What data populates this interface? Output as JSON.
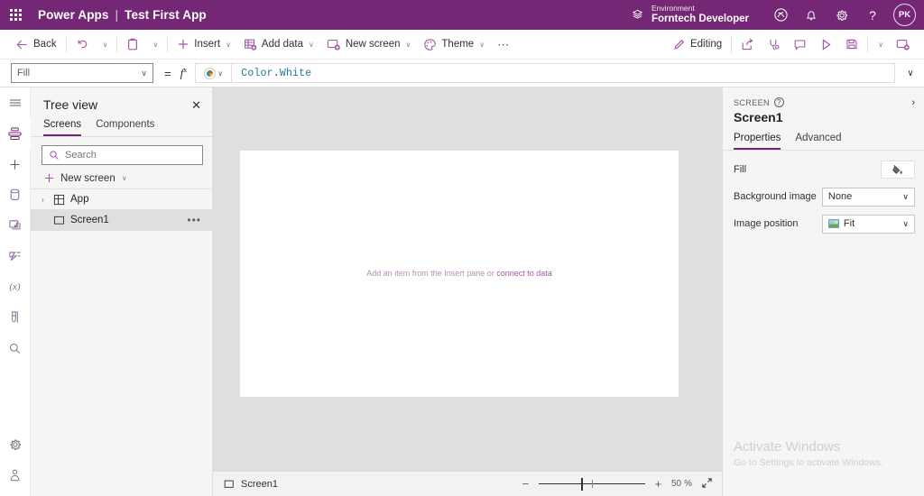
{
  "titlebar": {
    "waffle_label": "app-launcher",
    "product": "Power Apps",
    "separator": "|",
    "app_name": "Test First App",
    "environment_label": "Environment",
    "environment_name": "Forntech Developer",
    "icons": [
      "environment-icon",
      "copilot-icon",
      "notifications-icon",
      "settings-icon",
      "help-icon"
    ],
    "avatar_initials": "PK"
  },
  "commandbar": {
    "back": "Back",
    "undo": "undo-icon",
    "undo_chevron": "∨",
    "paste": "paste-icon",
    "paste_chevron": "∨",
    "insert": "Insert",
    "add_data": "Add data",
    "new_screen": "New screen",
    "theme": "Theme",
    "overflow": "⋯",
    "chevron": "∨",
    "editing": "Editing",
    "right_icons": [
      "share-icon",
      "check-app-icon",
      "comments-icon",
      "preview-icon",
      "save-icon",
      "save-chevron",
      "publish-icon"
    ]
  },
  "formulabar": {
    "property": "Fill",
    "property_chevron": "∨",
    "equals": "=",
    "fx": "fx",
    "swatch_name": "color-swatch",
    "swatch_chevron": "∨",
    "formula_object": "Color",
    "formula_dot": ".",
    "formula_member": "White",
    "expand_chevron": "∨"
  },
  "rail": {
    "items": [
      {
        "name": "hamburger-menu-icon",
        "glyph": "≡"
      },
      {
        "name": "tree-view-icon",
        "glyph": "☰"
      },
      {
        "name": "insert-icon",
        "glyph": "+"
      },
      {
        "name": "data-icon",
        "glyph": "⛁"
      },
      {
        "name": "media-icon",
        "glyph": "❐"
      },
      {
        "name": "power-automate-icon",
        "glyph": "➤"
      },
      {
        "name": "variables-icon",
        "glyph": "(x)"
      },
      {
        "name": "test-studio-icon",
        "glyph": "⚗"
      },
      {
        "name": "search-icon",
        "glyph": "⌕"
      }
    ],
    "bottom_items": [
      {
        "name": "settings-icon",
        "glyph": "⚙"
      },
      {
        "name": "account-icon",
        "glyph": "♟"
      }
    ]
  },
  "treeview": {
    "title": "Tree view",
    "close": "✕",
    "tabs": [
      {
        "label": "Screens",
        "selected": true
      },
      {
        "label": "Components",
        "selected": false
      }
    ],
    "search_placeholder": "Search",
    "search_value": "",
    "new_screen": "New screen",
    "new_screen_chevron": "∨",
    "rows": [
      {
        "label": "App",
        "caret": "›",
        "icon": "app-icon",
        "selected": false,
        "ellipsis": ""
      },
      {
        "label": "Screen1",
        "caret": "",
        "icon": "screen-icon",
        "selected": true,
        "ellipsis": "•••"
      }
    ]
  },
  "canvas": {
    "hint_prefix": "Add an item from the Insert pane or ",
    "hint_link": "connect to data"
  },
  "statusbar": {
    "screen_label": "Screen1",
    "zoom_out": "−",
    "zoom_in": "+",
    "zoom_value": "50",
    "zoom_unit": "%",
    "fit_icon": "↗"
  },
  "properties": {
    "kicker": "SCREEN",
    "help": "?",
    "collapse": "›",
    "name": "Screen1",
    "tabs": [
      {
        "label": "Properties",
        "selected": true
      },
      {
        "label": "Advanced",
        "selected": false
      }
    ],
    "rows": [
      {
        "label": "Fill",
        "control": "color",
        "value": ""
      },
      {
        "label": "Background image",
        "control": "dropdown",
        "value": "None"
      },
      {
        "label": "Image position",
        "control": "dropdown-image",
        "value": "Fit"
      }
    ],
    "chevron": "∨"
  },
  "watermark": {
    "title": "Activate Windows",
    "subtitle": "Go to Settings to activate Windows."
  },
  "colors": {
    "brand_purple": "#742774",
    "accent_purple": "#a359a3",
    "canvas_grey": "#dfdfdf",
    "panel_grey": "#f5f5f3"
  }
}
